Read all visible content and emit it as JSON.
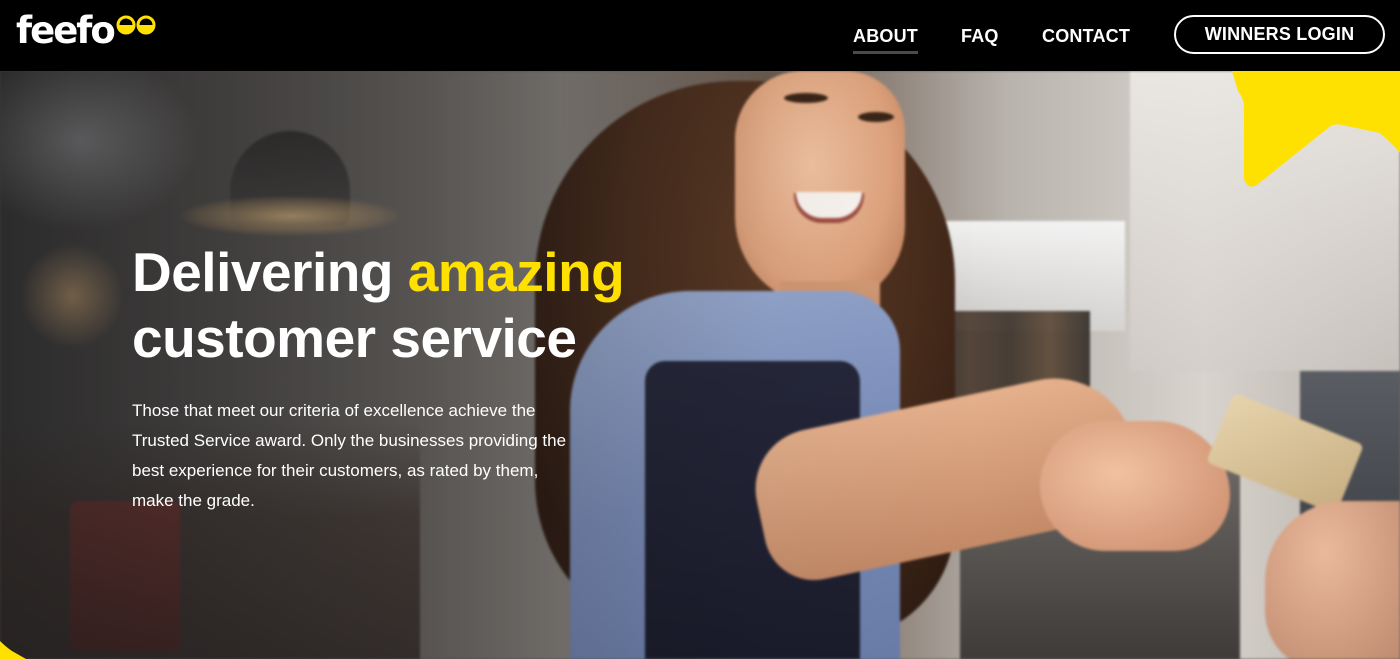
{
  "brand": {
    "logo_text": "feefo",
    "accent_color": "#fee001",
    "nav_background": "#000000"
  },
  "nav": {
    "links": [
      {
        "label": "ABOUT",
        "active": true
      },
      {
        "label": "FAQ",
        "active": false
      },
      {
        "label": "CONTACT",
        "active": false
      }
    ],
    "login_label": "WINNERS LOGIN"
  },
  "hero": {
    "title_part1": "Delivering ",
    "title_highlight": "amazing",
    "title_part2": "customer service",
    "description": "Those that meet our criteria of excellence achieve the Trusted Service award. Only the businesses providing the best experience for their customers, as rated by them, make the grade.",
    "image_subject": "smiling-barista-taking-card-payment"
  },
  "icons": [
    "logo-eyes-icon",
    "yellow-star-decoration-icon"
  ]
}
